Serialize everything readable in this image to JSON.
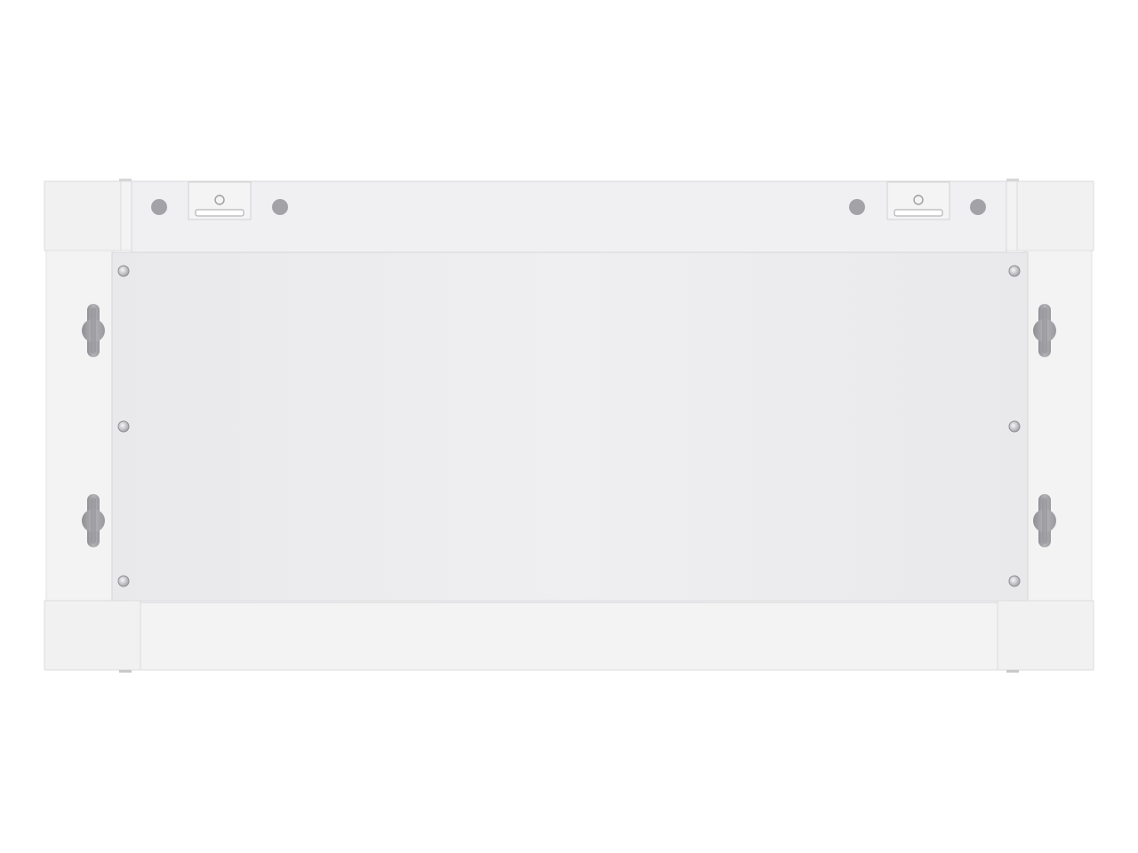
{
  "scene": {
    "subject_icon": "wall-mount-cabinet-back-panel-icon",
    "colors": {
      "background": "#ffffff",
      "panel": "#ececee",
      "panel_light": "#f2f2f3",
      "frame": "#efeff1",
      "edge": "#d6d6d9",
      "hole": "#a9a9ad",
      "hole_dark": "#8e8e92",
      "screw": "#b9b9bd"
    }
  }
}
